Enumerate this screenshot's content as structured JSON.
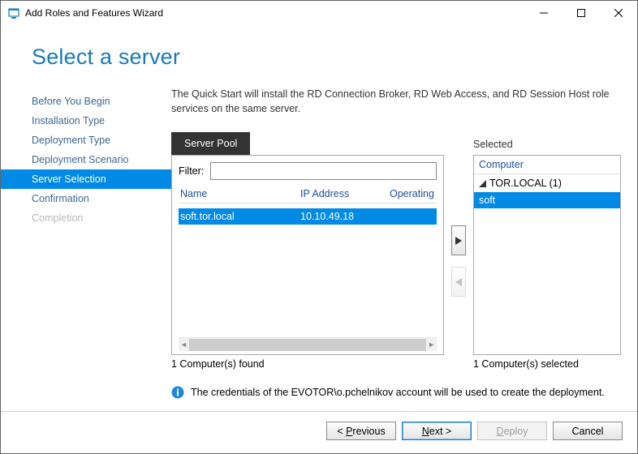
{
  "window": {
    "title": "Add Roles and Features Wizard"
  },
  "header": {
    "title": "Select a server"
  },
  "nav": {
    "items": [
      {
        "label": "Before You Begin",
        "state": "normal"
      },
      {
        "label": "Installation Type",
        "state": "normal"
      },
      {
        "label": "Deployment Type",
        "state": "normal"
      },
      {
        "label": "Deployment Scenario",
        "state": "normal"
      },
      {
        "label": "Server Selection",
        "state": "active"
      },
      {
        "label": "Confirmation",
        "state": "normal"
      },
      {
        "label": "Completion",
        "state": "disabled"
      }
    ]
  },
  "main": {
    "description": "The Quick Start will install the RD Connection Broker, RD Web Access, and RD Session Host role services on the same server.",
    "tab": "Server Pool",
    "filter_label": "Filter:",
    "filter_value": "",
    "columns": {
      "name": "Name",
      "ip": "IP Address",
      "os": "Operating"
    },
    "rows": [
      {
        "name": "soft.tor.local",
        "ip": "10.10.49.18",
        "selected": true
      }
    ],
    "found_text": "1 Computer(s) found",
    "selected_label": "Selected",
    "selected_header": "Computer",
    "tree": {
      "group": "TOR.LOCAL (1)",
      "item": "soft"
    },
    "selected_count_text": "1 Computer(s) selected",
    "info_text": "The credentials of the EVOTOR\\o.pchelnikov account will be used to create the deployment."
  },
  "footer": {
    "previous_pre": "< ",
    "previous_u": "P",
    "previous_post": "revious",
    "next_u": "N",
    "next_post": "ext >",
    "deploy_u": "D",
    "deploy_post": "eploy",
    "cancel": "Cancel"
  }
}
